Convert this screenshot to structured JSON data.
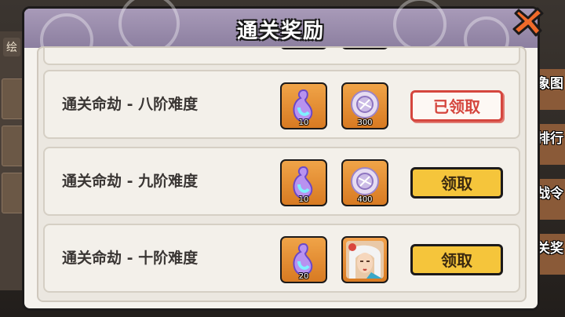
{
  "dialog": {
    "title": "通关奖励"
  },
  "background": {
    "left_label": "绘",
    "side_menu": [
      "象图",
      "排行",
      "战令",
      "关奖"
    ]
  },
  "rewards": [
    {
      "label": "通关命劫 - 八阶难度",
      "items": [
        {
          "icon": "gourd-icon",
          "count": "10"
        },
        {
          "icon": "crystal-coin-icon",
          "count": "300"
        }
      ],
      "button": "已领取",
      "status": "claimed"
    },
    {
      "label": "通关命劫 - 九阶难度",
      "items": [
        {
          "icon": "gourd-icon",
          "count": "10"
        },
        {
          "icon": "crystal-coin-icon",
          "count": "400"
        }
      ],
      "button": "领取",
      "status": "claimable"
    },
    {
      "label": "通关命劫 - 十阶难度",
      "items": [
        {
          "icon": "gourd-icon",
          "count": "20"
        },
        {
          "icon": "character-portrait-icon",
          "count": ""
        }
      ],
      "button": "领取",
      "status": "claimable"
    }
  ],
  "colors": {
    "header": "#9a8cae",
    "claim_button": "#f5c53b",
    "claimed_button_border": "#d5463e",
    "item_background": "#e08a2c"
  }
}
